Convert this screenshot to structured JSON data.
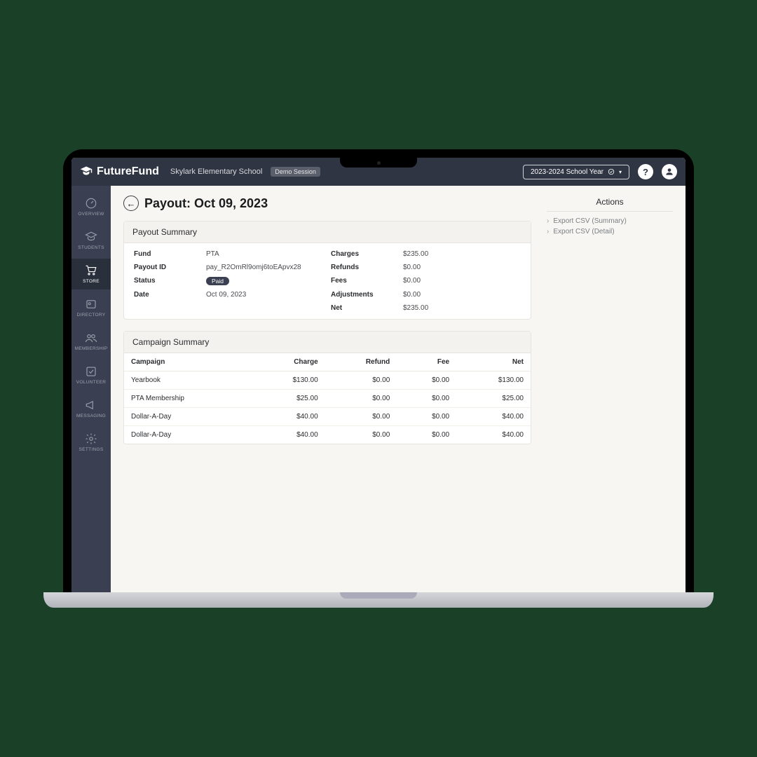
{
  "header": {
    "brand": "FutureFund",
    "school": "Skylark Elementary School",
    "demo_label": "Demo Session",
    "year_label": "2023-2024 School Year"
  },
  "sidebar": {
    "items": [
      {
        "label": "OVERVIEW"
      },
      {
        "label": "STUDENTS"
      },
      {
        "label": "STORE"
      },
      {
        "label": "DIRECTORY"
      },
      {
        "label": "MEMBERSHIP"
      },
      {
        "label": "VOLUNTEER"
      },
      {
        "label": "MESSAGING"
      },
      {
        "label": "SETTINGS"
      }
    ]
  },
  "page": {
    "title": "Payout: Oct 09, 2023"
  },
  "payout_summary": {
    "title": "Payout Summary",
    "left": {
      "fund_label": "Fund",
      "fund_value": "PTA",
      "id_label": "Payout ID",
      "id_value": "pay_R2OmRl9omj6toEApvx28",
      "status_label": "Status",
      "status_value": "Paid",
      "date_label": "Date",
      "date_value": "Oct 09, 2023"
    },
    "right": {
      "charges_label": "Charges",
      "charges_value": "$235.00",
      "refunds_label": "Refunds",
      "refunds_value": "$0.00",
      "fees_label": "Fees",
      "fees_value": "$0.00",
      "adjust_label": "Adjustments",
      "adjust_value": "$0.00",
      "net_label": "Net",
      "net_value": "$235.00"
    }
  },
  "campaign_summary": {
    "title": "Campaign Summary",
    "headers": {
      "campaign": "Campaign",
      "charge": "Charge",
      "refund": "Refund",
      "fee": "Fee",
      "net": "Net"
    },
    "rows": [
      {
        "campaign": "Yearbook",
        "charge": "$130.00",
        "refund": "$0.00",
        "fee": "$0.00",
        "net": "$130.00"
      },
      {
        "campaign": "PTA Membership",
        "charge": "$25.00",
        "refund": "$0.00",
        "fee": "$0.00",
        "net": "$25.00"
      },
      {
        "campaign": "Dollar-A-Day",
        "charge": "$40.00",
        "refund": "$0.00",
        "fee": "$0.00",
        "net": "$40.00"
      },
      {
        "campaign": "Dollar-A-Day",
        "charge": "$40.00",
        "refund": "$0.00",
        "fee": "$0.00",
        "net": "$40.00"
      }
    ]
  },
  "actions": {
    "title": "Actions",
    "items": [
      {
        "label": "Export CSV (Summary)"
      },
      {
        "label": "Export CSV (Detail)"
      }
    ]
  }
}
